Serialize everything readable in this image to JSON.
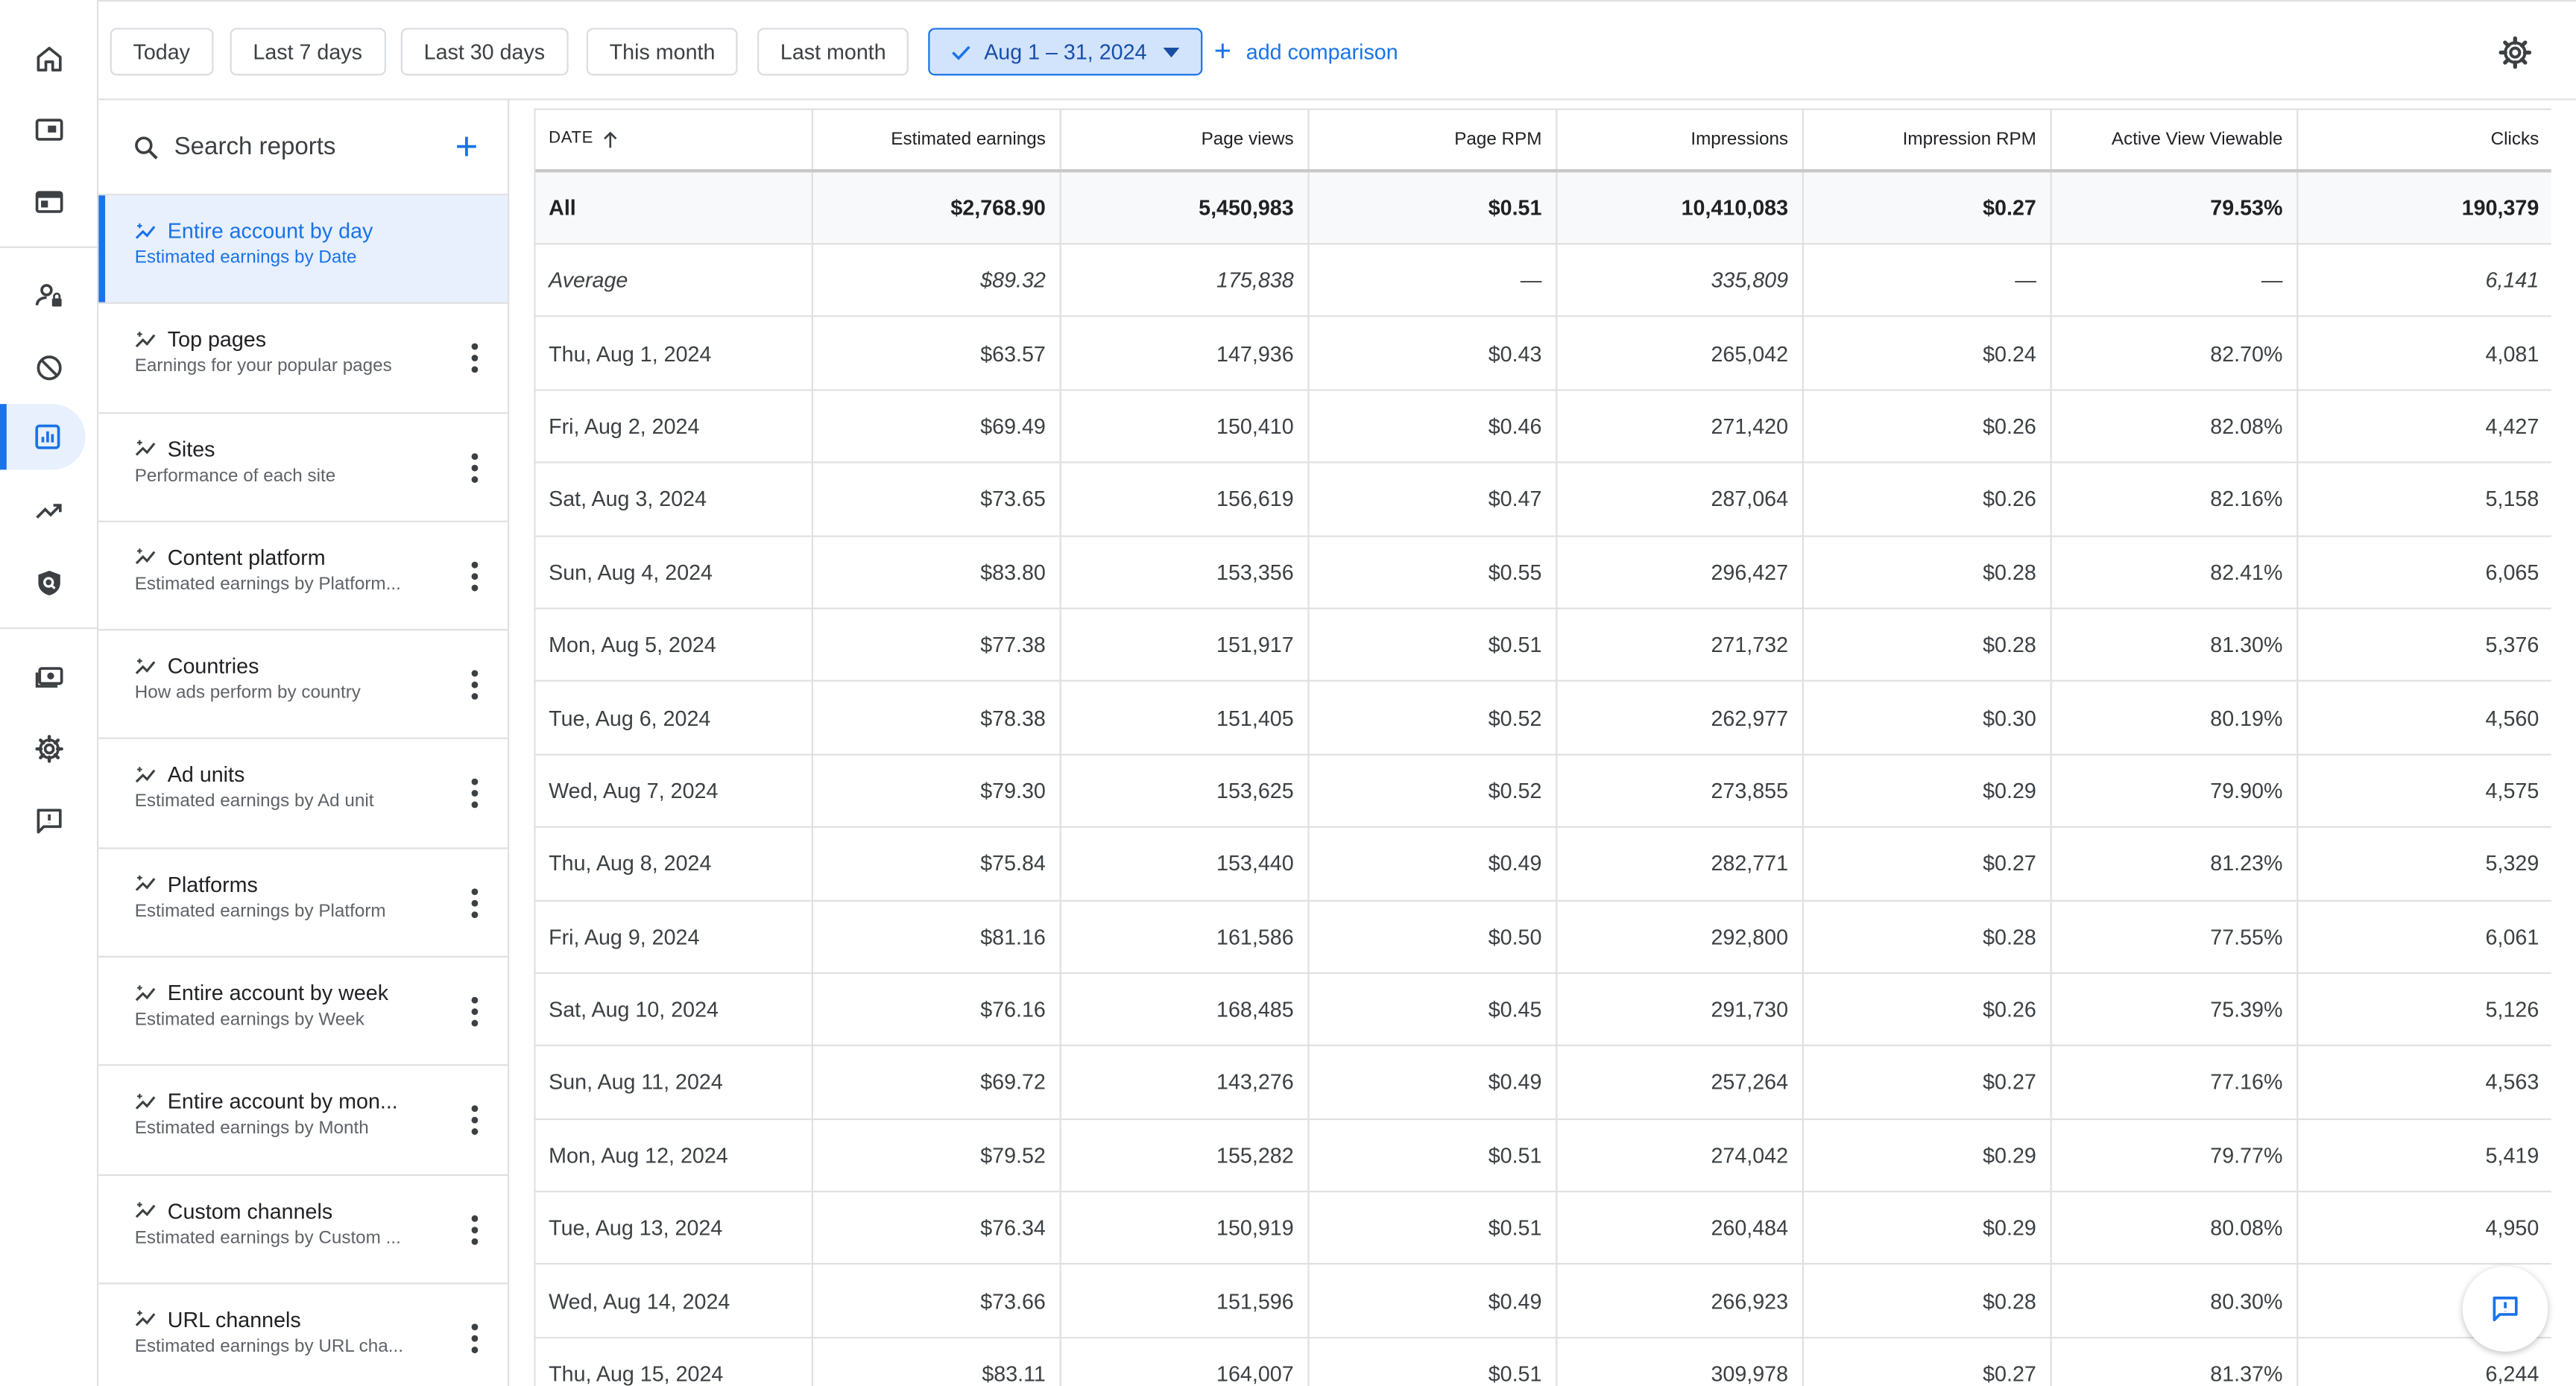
{
  "rail": {
    "icons": [
      "home-icon",
      "ads-icon",
      "sites-icon",
      "privacy-messaging-icon",
      "blocking-controls-icon",
      "reports-icon",
      "optimization-icon",
      "brand-safety-icon",
      "payments-icon",
      "settings-icon",
      "feedback-icon"
    ]
  },
  "topbar": {
    "chips": [
      "Today",
      "Last 7 days",
      "Last 30 days",
      "This month",
      "Last month"
    ],
    "selected_range": "Aug 1 – 31, 2024",
    "add_comparison": "add comparison"
  },
  "reports": {
    "search_placeholder": "Search reports",
    "items": [
      {
        "title": "Entire account by day",
        "subtitle": "Estimated earnings by Date"
      },
      {
        "title": "Top pages",
        "subtitle": "Earnings for your popular pages"
      },
      {
        "title": "Sites",
        "subtitle": "Performance of each site"
      },
      {
        "title": "Content platform",
        "subtitle": "Estimated earnings by Platform..."
      },
      {
        "title": "Countries",
        "subtitle": "How ads perform by country"
      },
      {
        "title": "Ad units",
        "subtitle": "Estimated earnings by Ad unit"
      },
      {
        "title": "Platforms",
        "subtitle": "Estimated earnings by Platform"
      },
      {
        "title": "Entire account by week",
        "subtitle": "Estimated earnings by Week"
      },
      {
        "title": "Entire account by mon...",
        "subtitle": "Estimated earnings by Month"
      },
      {
        "title": "Custom channels",
        "subtitle": "Estimated earnings by Custom ..."
      },
      {
        "title": "URL channels",
        "subtitle": "Estimated earnings by URL cha..."
      }
    ]
  },
  "table": {
    "headers": [
      "DATE",
      "Estimated earnings",
      "Page views",
      "Page RPM",
      "Impressions",
      "Impression RPM",
      "Active View Viewable",
      "Clicks"
    ],
    "all": [
      "All",
      "$2,768.90",
      "5,450,983",
      "$0.51",
      "10,410,083",
      "$0.27",
      "79.53%",
      "190,379"
    ],
    "average": [
      "Average",
      "$89.32",
      "175,838",
      "—",
      "335,809",
      "—",
      "—",
      "6,141"
    ],
    "rows": [
      [
        "Thu, Aug 1, 2024",
        "$63.57",
        "147,936",
        "$0.43",
        "265,042",
        "$0.24",
        "82.70%",
        "4,081"
      ],
      [
        "Fri, Aug 2, 2024",
        "$69.49",
        "150,410",
        "$0.46",
        "271,420",
        "$0.26",
        "82.08%",
        "4,427"
      ],
      [
        "Sat, Aug 3, 2024",
        "$73.65",
        "156,619",
        "$0.47",
        "287,064",
        "$0.26",
        "82.16%",
        "5,158"
      ],
      [
        "Sun, Aug 4, 2024",
        "$83.80",
        "153,356",
        "$0.55",
        "296,427",
        "$0.28",
        "82.41%",
        "6,065"
      ],
      [
        "Mon, Aug 5, 2024",
        "$77.38",
        "151,917",
        "$0.51",
        "271,732",
        "$0.28",
        "81.30%",
        "5,376"
      ],
      [
        "Tue, Aug 6, 2024",
        "$78.38",
        "151,405",
        "$0.52",
        "262,977",
        "$0.30",
        "80.19%",
        "4,560"
      ],
      [
        "Wed, Aug 7, 2024",
        "$79.30",
        "153,625",
        "$0.52",
        "273,855",
        "$0.29",
        "79.90%",
        "4,575"
      ],
      [
        "Thu, Aug 8, 2024",
        "$75.84",
        "153,440",
        "$0.49",
        "282,771",
        "$0.27",
        "81.23%",
        "5,329"
      ],
      [
        "Fri, Aug 9, 2024",
        "$81.16",
        "161,586",
        "$0.50",
        "292,800",
        "$0.28",
        "77.55%",
        "6,061"
      ],
      [
        "Sat, Aug 10, 2024",
        "$76.16",
        "168,485",
        "$0.45",
        "291,730",
        "$0.26",
        "75.39%",
        "5,126"
      ],
      [
        "Sun, Aug 11, 2024",
        "$69.72",
        "143,276",
        "$0.49",
        "257,264",
        "$0.27",
        "77.16%",
        "4,563"
      ],
      [
        "Mon, Aug 12, 2024",
        "$79.52",
        "155,282",
        "$0.51",
        "274,042",
        "$0.29",
        "79.77%",
        "5,419"
      ],
      [
        "Tue, Aug 13, 2024",
        "$76.34",
        "150,919",
        "$0.51",
        "260,484",
        "$0.29",
        "80.08%",
        "4,950"
      ],
      [
        "Wed, Aug 14, 2024",
        "$73.66",
        "151,596",
        "$0.49",
        "266,923",
        "$0.28",
        "80.30%",
        ""
      ],
      [
        "Thu, Aug 15, 2024",
        "$83.11",
        "164,007",
        "$0.51",
        "309,978",
        "$0.27",
        "81.37%",
        "6,244"
      ]
    ]
  },
  "colors": {
    "accent": "#1a73e8",
    "selected_bg": "#e8f0fe",
    "border": "#e0e0e0"
  },
  "fab": {
    "icon": "feedback-bubble-icon"
  }
}
